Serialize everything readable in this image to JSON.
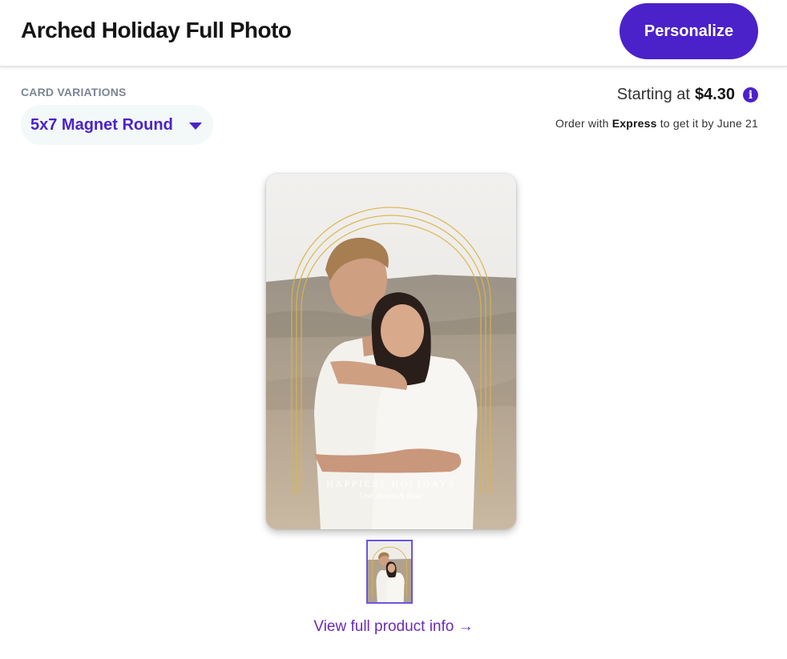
{
  "header": {
    "title": "Arched Holiday Full Photo",
    "personalize_label": "Personalize"
  },
  "variations": {
    "label": "CARD VARIATIONS",
    "selected": "5x7 Magnet Round"
  },
  "pricing": {
    "prefix": "Starting at",
    "price": "$4.30",
    "info_icon": "i",
    "delivery_prefix": "Order with",
    "delivery_method": "Express",
    "delivery_suffix": "to get it by June 21"
  },
  "card": {
    "greeting": "HAPPIEST HOLIDAYS",
    "signature": "Love, Megan & Blake"
  },
  "footer": {
    "view_link": "View full product info →"
  },
  "colors": {
    "accent": "#4b22c9",
    "link": "#6a2bb8",
    "arch": "#d9b44a"
  }
}
